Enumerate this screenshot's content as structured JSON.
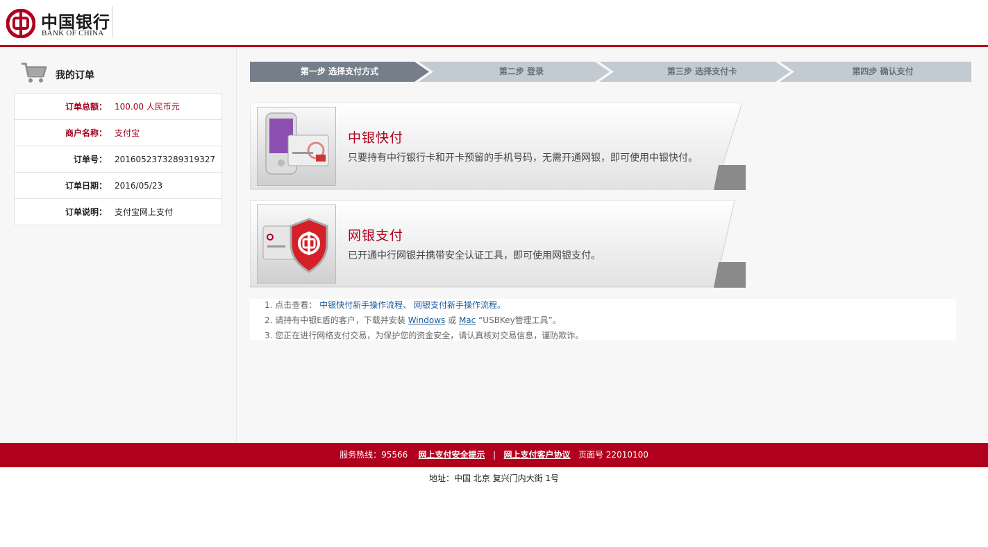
{
  "header": {
    "logo_cn": "中国银行",
    "logo_en": "BANK OF CHINA"
  },
  "order": {
    "title": "我的订单",
    "rows": [
      {
        "label": "订单总额：",
        "value": "100.00 人民币元"
      },
      {
        "label": "商户名称：",
        "value": "支付宝"
      },
      {
        "label": "订单号：",
        "value": "2016052373289319327"
      },
      {
        "label": "订单日期：",
        "value": "2016/05/23"
      },
      {
        "label": "订单说明：",
        "value": "支付宝网上支付"
      }
    ]
  },
  "steps": [
    {
      "label": "第一步  选择支付方式",
      "active": true
    },
    {
      "label": "第二步  登录",
      "active": false
    },
    {
      "label": "第三步  选择支付卡",
      "active": false
    },
    {
      "label": "第四步  确认支付",
      "active": false
    }
  ],
  "payment_methods": [
    {
      "title": "中银快付",
      "desc": "只要持有中行银行卡和开卡预留的手机号码，无需开通网银，即可使用中银快付。",
      "icon": "phone-card-icon"
    },
    {
      "title": "网银支付",
      "desc": "已开通中行网银并携带安全认证工具，即可使用网银支付。",
      "icon": "shield-card-icon"
    }
  ],
  "notes": {
    "n1_prefix": "1. 点击查看：",
    "n1_link1": "中银快付新手操作流程",
    "n1_sep": "、",
    "n1_link2": "网银支付新手操作流程。",
    "n2_prefix": "2. 请持有中银E盾的客户，下载并安装",
    "n2_windows": "Windows",
    "n2_or": "或",
    "n2_mac": "Mac",
    "n2_suffix": "“USBKey管理工具”。",
    "n3": "3. 您正在进行网络支付交易，为保护您的资金安全，请认真核对交易信息，谨防欺诈。"
  },
  "footer": {
    "hotline": "服务热线：95566",
    "link1": "网上支付安全提示",
    "sep": "|",
    "link2": "网上支付客户协议",
    "page_no": "页面号 22010100",
    "address": "地址：中国 北京 复兴门内大街 1号"
  },
  "colors": {
    "brand": "#b1001d",
    "step_active": "#747f8a",
    "step_inactive": "#c2cad2"
  }
}
